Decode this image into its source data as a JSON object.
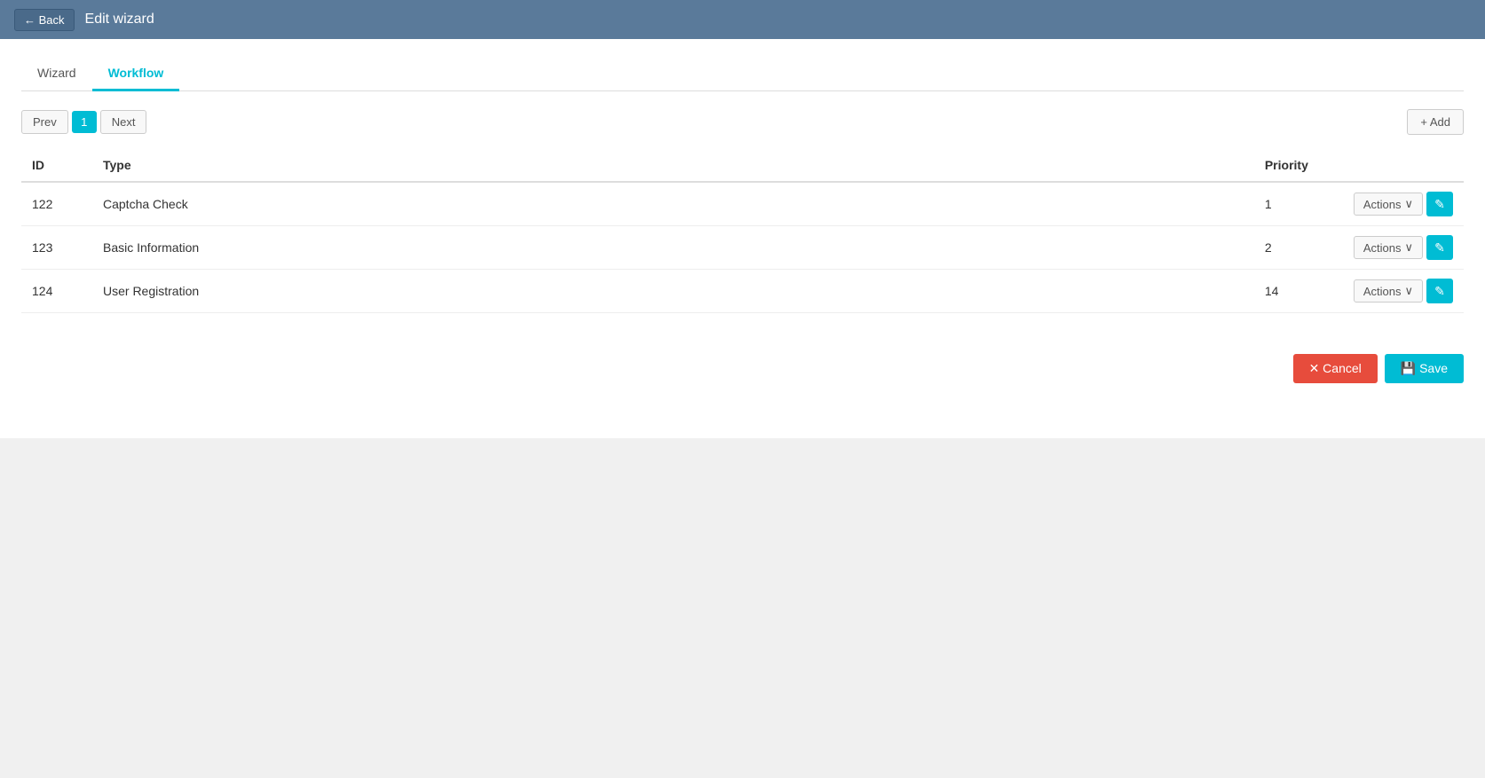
{
  "header": {
    "back_label": "← Back",
    "title": "Edit wizard"
  },
  "tabs": [
    {
      "id": "wizard",
      "label": "Wizard",
      "active": false
    },
    {
      "id": "workflow",
      "label": "Workflow",
      "active": true
    }
  ],
  "pagination": {
    "prev_label": "Prev",
    "page_number": "1",
    "next_label": "Next"
  },
  "add_button_label": "+ Add",
  "table": {
    "columns": [
      {
        "key": "id",
        "label": "ID"
      },
      {
        "key": "type",
        "label": "Type"
      },
      {
        "key": "priority",
        "label": "Priority"
      }
    ],
    "rows": [
      {
        "id": "122",
        "type": "Captcha Check",
        "priority": "1"
      },
      {
        "id": "123",
        "type": "Basic Information",
        "priority": "2"
      },
      {
        "id": "124",
        "type": "User Registration",
        "priority": "14"
      }
    ],
    "actions_label": "Actions",
    "actions_chevron": "∨",
    "edit_icon": "✎"
  },
  "footer": {
    "cancel_label": "✕ Cancel",
    "save_label": "💾 Save"
  }
}
